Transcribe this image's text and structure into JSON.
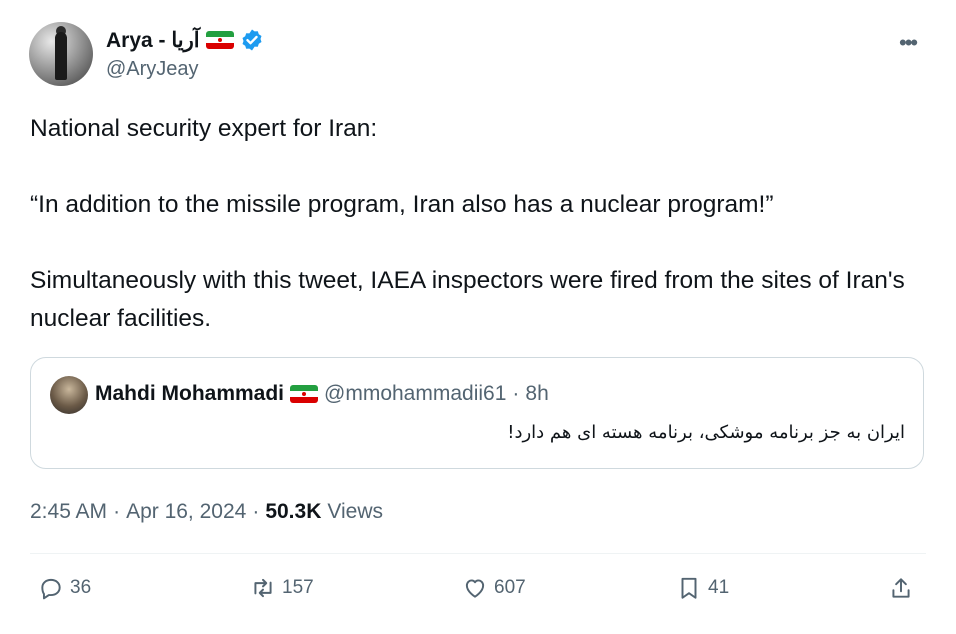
{
  "author": {
    "display_name": "Arya - آریا",
    "handle": "@AryJeay"
  },
  "tweet": {
    "line1": "National security expert for Iran:",
    "line2": "“In addition to the missile program, Iran also has a nuclear program!”",
    "line3": "Simultaneously with this tweet, IAEA inspectors were fired from the sites of Iran's nuclear facilities."
  },
  "quoted": {
    "display_name": "Mahdi Mohammadi",
    "handle": "@mmohammadii61",
    "separator": "·",
    "time": "8h",
    "text": "ایران به جز برنامه موشکی، برنامه هسته ای هم دارد!"
  },
  "meta": {
    "time": "2:45 AM",
    "sep1": "·",
    "date": "Apr 16, 2024",
    "sep2": "·",
    "views_count": "50.3K",
    "views_label": "Views"
  },
  "actions": {
    "replies": "36",
    "reposts": "157",
    "likes": "607",
    "bookmarks": "41"
  },
  "more_label": "•••",
  "colors": {
    "text": "#0f1419",
    "secondary": "#536471",
    "verified": "#1d9bf0",
    "border": "#cfd9de"
  }
}
